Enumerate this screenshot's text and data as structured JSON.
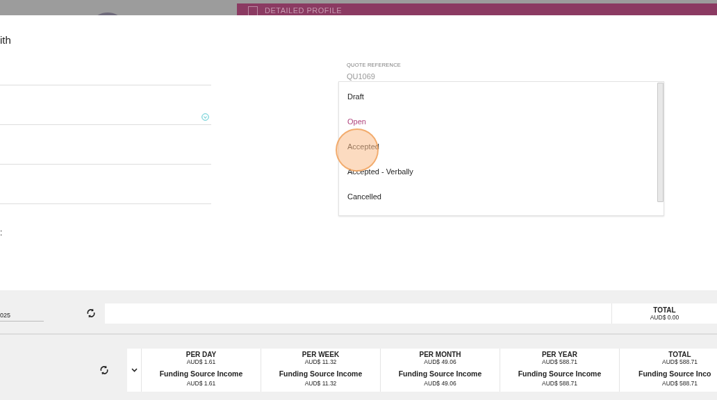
{
  "background": {
    "header_title": "DETAILED PROFILE"
  },
  "modal": {
    "title_fragment": "ith",
    "label_fragment": ":"
  },
  "quote_reference": {
    "label": "QUOTE REFERENCE",
    "value": "QU1069"
  },
  "status_dropdown": {
    "options": [
      {
        "label": "Draft",
        "selected": false
      },
      {
        "label": "Open",
        "selected": true
      },
      {
        "label": "Accepted",
        "selected": false
      },
      {
        "label": "Accepted - Verbally",
        "selected": false
      },
      {
        "label": "Cancelled",
        "selected": false
      }
    ]
  },
  "totals_bar": {
    "date_value": "025",
    "total_label": "TOTAL",
    "total_value": "AUD$ 0.00"
  },
  "summary_table": {
    "columns": [
      {
        "period": "PER DAY",
        "period_amount": "AUD$ 1.61",
        "source": "Funding Source Income",
        "source_amount": "AUD$ 1.61"
      },
      {
        "period": "PER WEEK",
        "period_amount": "AUD$ 11.32",
        "source": "Funding Source Income",
        "source_amount": "AUD$ 11.32"
      },
      {
        "period": "PER MONTH",
        "period_amount": "AUD$ 49.06",
        "source": "Funding Source Income",
        "source_amount": "AUD$ 49.06"
      },
      {
        "period": "PER YEAR",
        "period_amount": "AUD$ 588.71",
        "source": "Funding Source Income",
        "source_amount": "AUD$ 588.71"
      },
      {
        "period": "TOTAL",
        "period_amount": "AUD$ 588.71",
        "source": "Funding Source Inco",
        "source_amount": "AUD$ 588.71"
      }
    ]
  }
}
